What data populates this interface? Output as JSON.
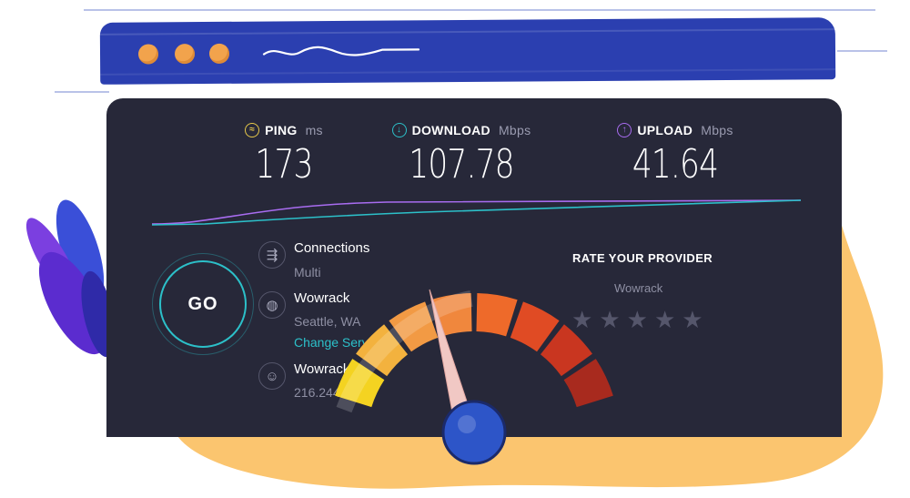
{
  "metrics": {
    "ping": {
      "label": "PING",
      "unit": "ms",
      "value": "173",
      "icon": "ping-icon",
      "color": "#e6c84a"
    },
    "download": {
      "label": "DOWNLOAD",
      "unit": "Mbps",
      "value": "107.78",
      "icon": "download-arrow-icon",
      "color": "#2cc0c9"
    },
    "upload": {
      "label": "UPLOAD",
      "unit": "Mbps",
      "value": "41.64",
      "icon": "upload-arrow-icon",
      "color": "#a86cf0"
    }
  },
  "go_button": {
    "label": "GO",
    "color": "#2cc0c9"
  },
  "connections": {
    "title": "Connections",
    "value": "Multi",
    "icon": "connections-icon"
  },
  "server": {
    "title": "Wowrack",
    "location": "Seattle, WA",
    "change_label": "Change Server",
    "icon": "globe-icon"
  },
  "provider": {
    "title": "Wowrack",
    "ip": "216.244.92.50",
    "icon": "user-icon"
  },
  "rating": {
    "title": "RATE YOUR PROVIDER",
    "provider": "Wowrack",
    "stars": 5,
    "star_icon": "star-icon"
  },
  "colors": {
    "panel": "#272839",
    "titlebar": "#2b3fb0",
    "accent": "#2cc0c9",
    "upload": "#a86cf0",
    "blob": "#fbc56f"
  }
}
